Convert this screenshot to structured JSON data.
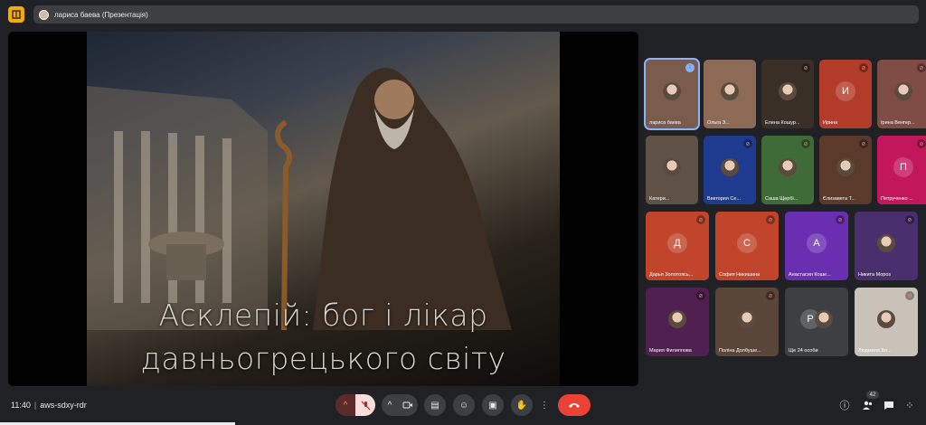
{
  "presenter": {
    "label": "лариса баева (Презентація)"
  },
  "slide": {
    "line1": "Асклепій: бог і лікар",
    "line2": "давньогрецького світу"
  },
  "participants": [
    {
      "name": "лариса баева",
      "kind": "photo",
      "color": "#7a5c4f",
      "indicator": "speaking"
    },
    {
      "name": "Ольга З...",
      "kind": "photo",
      "color": "#8c6a55",
      "indicator": "none"
    },
    {
      "name": "Елена Кошур...",
      "kind": "photo",
      "color": "#3a2f26",
      "indicator": "muted"
    },
    {
      "name": "Ирина",
      "kind": "letter",
      "letter": "И",
      "color": "#b23b2a",
      "indicator": "muted"
    },
    {
      "name": "Ірина Венгер...",
      "kind": "photo",
      "color": "#7f4b45",
      "indicator": "muted"
    },
    {
      "name": "Катери...",
      "kind": "photo",
      "color": "#5e5246",
      "indicator": "none"
    },
    {
      "name": "Виктория Се...",
      "kind": "photo",
      "color": "#1f3b8f",
      "indicator": "muted"
    },
    {
      "name": "Саша Щербі...",
      "kind": "photo",
      "color": "#3f6b38",
      "indicator": "muted"
    },
    {
      "name": "Єлизавета Т...",
      "kind": "photo",
      "color": "#5b3a2c",
      "indicator": "muted"
    },
    {
      "name": "Петрученко ...",
      "kind": "letter",
      "letter": "П",
      "color": "#c2185b",
      "indicator": "muted"
    },
    {
      "name": "Дарья Золотоясь...",
      "kind": "letter",
      "letter": "Д",
      "color": "#c0452b",
      "indicator": "muted"
    },
    {
      "name": "София Никишина",
      "kind": "letter",
      "letter": "С",
      "color": "#c0452b",
      "indicator": "muted"
    },
    {
      "name": "Анастасия Коше...",
      "kind": "letter",
      "letter": "А",
      "color": "#6a2fb0",
      "indicator": "muted"
    },
    {
      "name": "Никита Мороз",
      "kind": "photo",
      "color": "#4a2f6e",
      "indicator": "muted"
    },
    {
      "name": "Мария Филиппова",
      "kind": "photo",
      "color": "#4f1f4f",
      "indicator": "muted"
    },
    {
      "name": "Поліна Долбуше...",
      "kind": "photo",
      "color": "#5a4638",
      "indicator": "muted"
    },
    {
      "name": "Ще 24 особи",
      "kind": "more",
      "letter": "Р",
      "color": "#3c4043",
      "indicator": "none"
    },
    {
      "name": "Людмила Бо...",
      "kind": "photo",
      "color": "#c9c2b8",
      "indicator": "muted"
    }
  ],
  "bottombar": {
    "time": "11:40",
    "separator": "|",
    "meeting_code": "aws-sdxy-rdr",
    "people_count": "42"
  },
  "icons": {
    "chevron": "^",
    "mic_off": "🎙",
    "camera": "▭",
    "captions": "▤",
    "emoji": "☺",
    "present": "▣",
    "hand": "✋",
    "more": "⋮",
    "hangup": "☎",
    "info": "ⓘ",
    "people": "👥",
    "chat": "💬",
    "activities": "⁘"
  },
  "colors": {
    "hangup": "#ea4335",
    "accent": "#8ab4f8",
    "background": "#202124"
  }
}
